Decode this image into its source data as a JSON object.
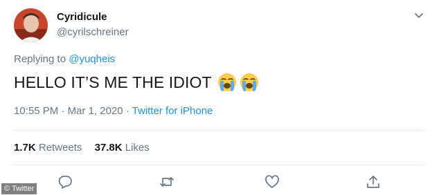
{
  "user": {
    "display_name": "Cyridicule",
    "handle": "@cyrilschreiner"
  },
  "reply": {
    "prefix": "Replying to ",
    "mention": "@yuqheis"
  },
  "tweet": {
    "text": "HELLO IT’S ME THE IDIOT",
    "emojis": [
      "loudly-crying-face-icon",
      "loudly-crying-face-icon"
    ]
  },
  "meta": {
    "time": "10:55 PM",
    "separator1": " · ",
    "date": "Mar 1, 2020",
    "separator2": " · ",
    "source": "Twitter for iPhone"
  },
  "stats": {
    "retweets_count": "1.7K",
    "retweets_label": " Retweets",
    "likes_count": "37.8K",
    "likes_label": " Likes"
  },
  "actions": [
    "reply-icon",
    "retweet-icon",
    "like-icon",
    "share-icon"
  ],
  "watermark": "© Twitter",
  "colors": {
    "text": "#14171a",
    "secondary": "#657786",
    "link": "#1b95e0",
    "divider": "#e6ecf0"
  }
}
